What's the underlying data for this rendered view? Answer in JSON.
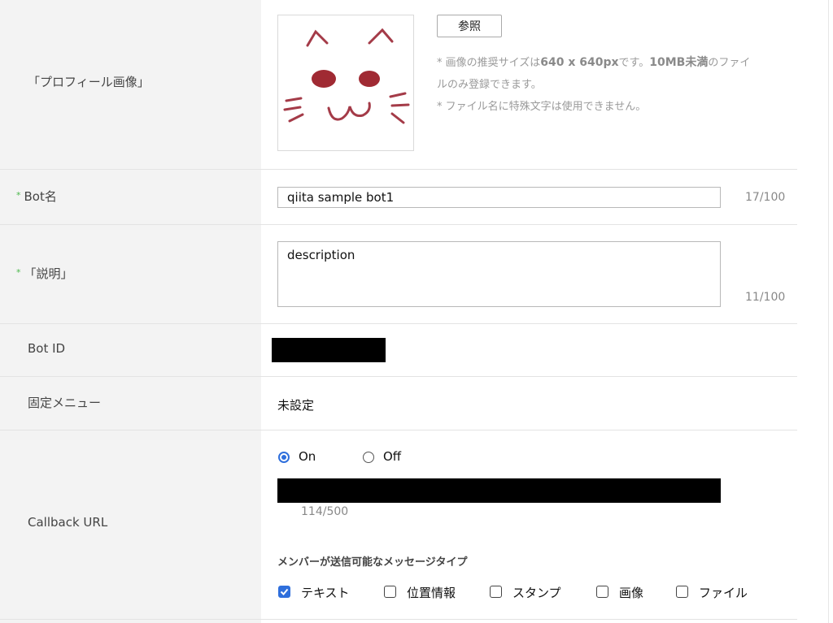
{
  "profile": {
    "label": "「プロフィール画像」",
    "browse_button": "参照",
    "hint_line1_a": "* 画像の推奨サイズは",
    "hint_line1_b": "640 x 640px",
    "hint_line1_c": "です。",
    "hint_line1_d": "10MB未満",
    "hint_line1_e": "のファイ",
    "hint_line2": "ルのみ登録できます。",
    "hint_line3": "* ファイル名に特殊文字は使用できません。"
  },
  "bot_name": {
    "required_mark": "*",
    "label": "Bot名",
    "value": "qiita sample bot1",
    "count": "17/100"
  },
  "description": {
    "required_mark": "*",
    "label": "「説明」",
    "value": "description",
    "count": "11/100"
  },
  "bot_id": {
    "label": "Bot ID"
  },
  "fixed_menu": {
    "label": "固定メニュー",
    "value": "未設定"
  },
  "callback": {
    "label": "Callback URL",
    "on_label": "On",
    "off_label": "Off",
    "count": "114/500",
    "section_title": "メンバーが送信可能なメッセージタイプ",
    "types": [
      {
        "label": "テキスト",
        "checked": true
      },
      {
        "label": "位置情報",
        "checked": false
      },
      {
        "label": "スタンプ",
        "checked": false
      },
      {
        "label": "画像",
        "checked": false
      },
      {
        "label": "ファイル",
        "checked": false
      }
    ]
  },
  "colors": {
    "accent": "#2f6fdc",
    "required": "#4cb84c",
    "label_bg": "#f3f3f3"
  }
}
